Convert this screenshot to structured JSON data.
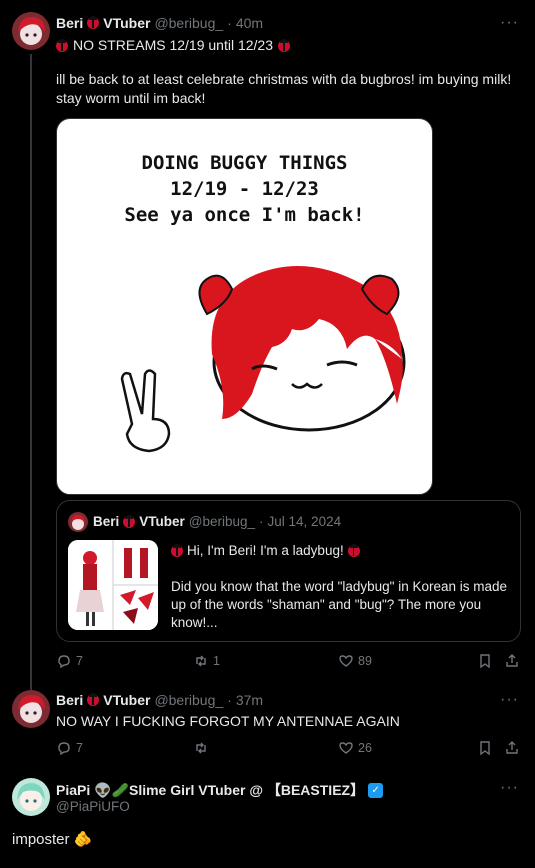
{
  "post1": {
    "name": "Beri",
    "suffix": "VTuber",
    "handle": "@beribug_",
    "dot": "·",
    "time": "40m",
    "title_line": "NO STREAMS 12/19 until 12/23",
    "body": "ill be back to at least celebrate christmas with da bugbros! im buying milk! stay worm until im back!",
    "image_caption": [
      "DOING BUGGY THINGS",
      "12/19 - 12/23",
      "See ya once I'm back!"
    ],
    "replies": "7",
    "reposts": "1",
    "likes": "89"
  },
  "quote": {
    "name": "Beri",
    "suffix": "VTuber",
    "handle": "@beribug_",
    "dot": "·",
    "time": "Jul 14, 2024",
    "line1": "Hi, I'm Beri! I'm a ladybug!",
    "line2": "Did you know that the word \"ladybug\" in Korean is made up of the words \"shaman\" and \"bug\"? The more you know!..."
  },
  "post2": {
    "name": "Beri",
    "suffix": "VTuber",
    "handle": "@beribug_",
    "dot": "·",
    "time": "37m",
    "body": "NO WAY I FUCKING FORGOT MY ANTENNAE AGAIN",
    "replies": "7",
    "reposts": "",
    "likes": "26"
  },
  "post3": {
    "name": "PiaPi 👽🥒Slime Girl VTuber @ 【BEASTIEZ】",
    "handle": "@PiaPiUFO",
    "body": "imposter 🫵"
  },
  "more_label": "···",
  "colors": {
    "accent_red": "#c8102e",
    "muted": "#71767b",
    "verified_blue": "#1d9bf0"
  }
}
